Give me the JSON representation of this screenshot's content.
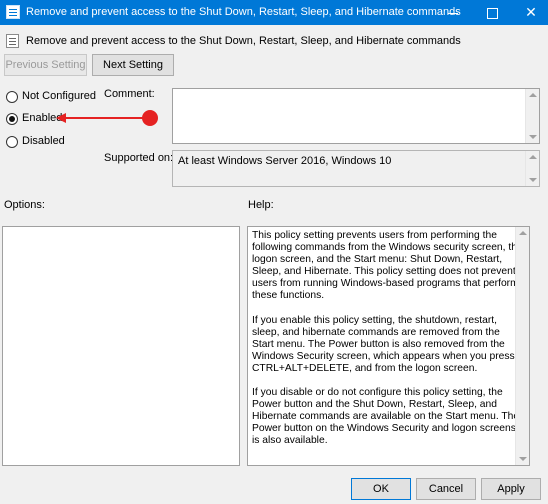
{
  "window": {
    "title": "Remove and prevent access to the Shut Down, Restart, Sleep, and Hibernate commands",
    "controls": {
      "minimize_icon": "minimize-icon",
      "maximize_icon": "maximize-icon",
      "close_glyph": "✕"
    }
  },
  "header": {
    "icon": "policy-setting-icon",
    "text": "Remove and prevent access to the Shut Down, Restart, Sleep, and Hibernate commands"
  },
  "nav": {
    "previous_label": "Previous Setting",
    "previous_enabled": false,
    "next_label": "Next Setting"
  },
  "state": {
    "options": [
      {
        "label": "Not Configured",
        "selected": false
      },
      {
        "label": "Enabled",
        "selected": true
      },
      {
        "label": "Disabled",
        "selected": false
      }
    ]
  },
  "annotation": {
    "color": "#e52222",
    "target": "Enabled"
  },
  "comment": {
    "label": "Comment:",
    "value": ""
  },
  "supported": {
    "label": "Supported on:",
    "value": "At least Windows Server 2016, Windows 10"
  },
  "panes": {
    "options_label": "Options:",
    "help_label": "Help:"
  },
  "help": {
    "paragraphs": [
      "This policy setting prevents users from performing the following commands from the Windows security screen, the logon screen, and the Start menu: Shut Down, Restart, Sleep, and Hibernate. This policy setting does not prevent users from running Windows-based programs that perform these functions.",
      "If you enable this policy setting, the shutdown, restart, sleep, and hibernate commands are removed from the Start menu. The Power button is also removed from the Windows Security screen, which appears when you press CTRL+ALT+DELETE, and from the logon screen.",
      "If you disable or do not configure this policy setting, the Power button and the Shut Down, Restart, Sleep, and Hibernate commands are available on the Start menu. The Power button on the Windows Security and logon screens is also available."
    ]
  },
  "footer": {
    "ok_label": "OK",
    "cancel_label": "Cancel",
    "apply_label": "Apply"
  },
  "colors": {
    "titlebar": "#0078d7",
    "background": "#f0f0f0",
    "accent": "#0078d7"
  }
}
